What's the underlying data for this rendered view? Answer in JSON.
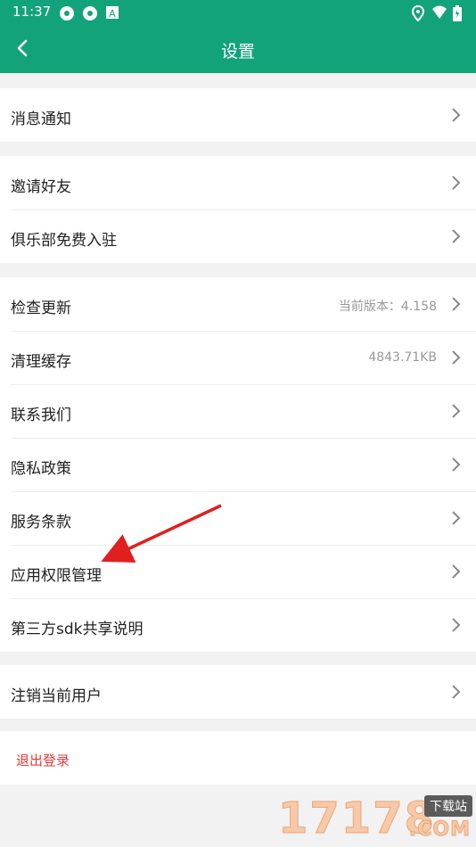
{
  "status_bar": {
    "time": "11:37",
    "icons": [
      "app-icon",
      "app-icon",
      "notification-a-icon",
      "location-icon",
      "wifi-icon",
      "battery-icon"
    ]
  },
  "app_bar": {
    "title": "设置"
  },
  "groups": {
    "g1": [
      {
        "label": "消息通知",
        "value": ""
      }
    ],
    "g2": [
      {
        "label": "邀请好友",
        "value": ""
      },
      {
        "label": "俱乐部免费入驻",
        "value": ""
      }
    ],
    "g3": [
      {
        "label": "检查更新",
        "value": "当前版本：4.158"
      },
      {
        "label": "清理缓存",
        "value": "4843.71KB"
      },
      {
        "label": "联系我们",
        "value": ""
      },
      {
        "label": "隐私政策",
        "value": ""
      },
      {
        "label": "服务条款",
        "value": ""
      },
      {
        "label": "应用权限管理",
        "value": ""
      },
      {
        "label": "第三方sdk共享说明",
        "value": ""
      }
    ],
    "g4": [
      {
        "label": "注销当前用户",
        "value": ""
      }
    ]
  },
  "logout": {
    "label": "退出登录"
  },
  "colors": {
    "accent": "#13a37b",
    "logout_text": "#e53935",
    "annotation_arrow": "#e02020"
  },
  "watermark": {
    "number": "17178",
    "tag": "下载站",
    "domain": ".COM"
  }
}
